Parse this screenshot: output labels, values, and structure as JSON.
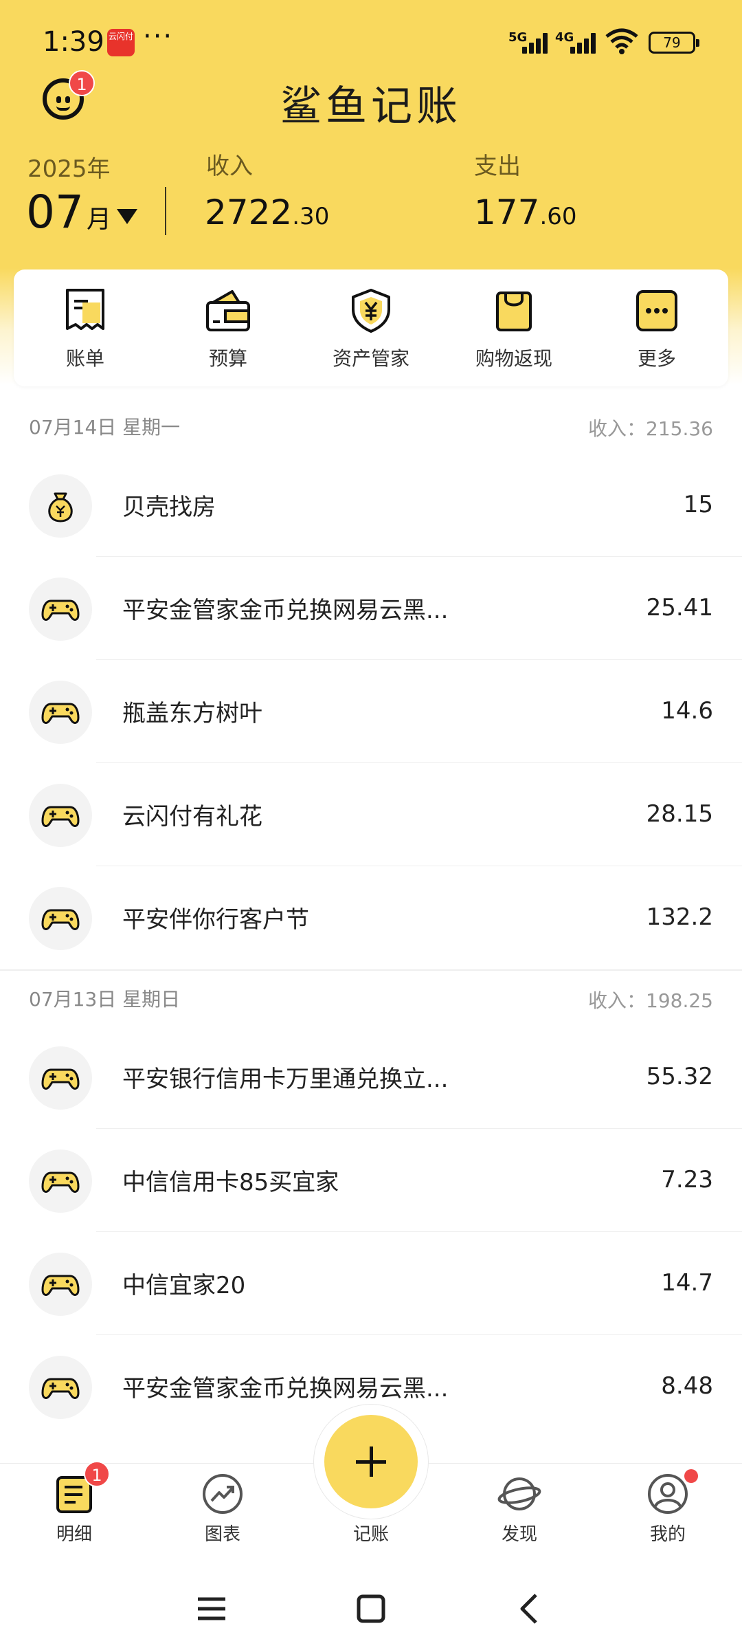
{
  "status": {
    "time": "1:39",
    "app_icon_text": "云闪付",
    "dots": "···",
    "net1": "5G",
    "net2": "4G",
    "battery": "79"
  },
  "header": {
    "title": "鲨鱼记账",
    "notification_count": "1",
    "year": "2025年",
    "month": "07",
    "month_unit": "月",
    "income_label": "收入",
    "income_int": "2722",
    "income_dec": ".30",
    "expense_label": "支出",
    "expense_int": "177",
    "expense_dec": ".60"
  },
  "quick_actions": [
    {
      "label": "账单",
      "icon": "bill-icon"
    },
    {
      "label": "预算",
      "icon": "wallet-icon"
    },
    {
      "label": "资产管家",
      "icon": "shield-yen-icon"
    },
    {
      "label": "购物返现",
      "icon": "shopping-bag-icon"
    },
    {
      "label": "更多",
      "icon": "more-icon"
    }
  ],
  "days": [
    {
      "date": "07月14日 星期一",
      "income": "收入：215.36",
      "entries": [
        {
          "name": "贝壳找房",
          "amount": "15",
          "icon": "money-bag-icon"
        },
        {
          "name": "平安金管家金币兑换网易云黑...",
          "amount": "25.41",
          "icon": "gamepad-icon"
        },
        {
          "name": "瓶盖东方树叶",
          "amount": "14.6",
          "icon": "gamepad-icon"
        },
        {
          "name": "云闪付有礼花",
          "amount": "28.15",
          "icon": "gamepad-icon"
        },
        {
          "name": "平安伴你行客户节",
          "amount": "132.2",
          "icon": "gamepad-icon"
        }
      ]
    },
    {
      "date": "07月13日 星期日",
      "income": "收入：198.25",
      "entries": [
        {
          "name": "平安银行信用卡万里通兑换立...",
          "amount": "55.32",
          "icon": "gamepad-icon"
        },
        {
          "name": "中信信用卡85买宜家",
          "amount": "7.23",
          "icon": "gamepad-icon"
        },
        {
          "name": "中信宜家20",
          "amount": "14.7",
          "icon": "gamepad-icon"
        },
        {
          "name": "平安金管家金币兑换网易云黑...",
          "amount": "8.48",
          "icon": "gamepad-icon"
        }
      ]
    }
  ],
  "tabs": [
    {
      "label": "明细",
      "badge": "1"
    },
    {
      "label": "图表"
    },
    {
      "label": "记账"
    },
    {
      "label": "发现"
    },
    {
      "label": "我的"
    }
  ],
  "colors": {
    "brand": "#f9d95e",
    "badge": "#f04848"
  }
}
